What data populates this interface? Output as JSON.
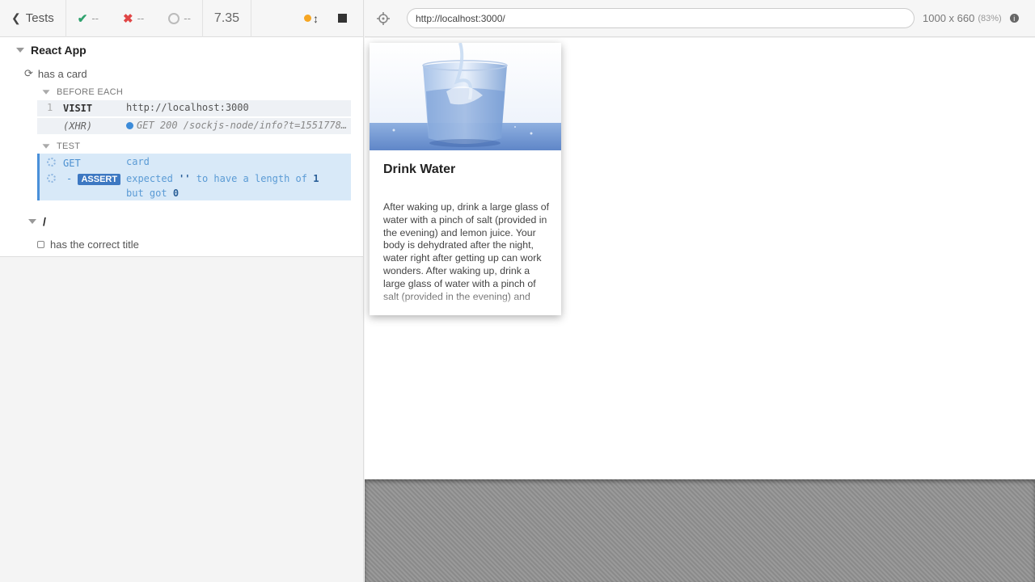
{
  "reporter": {
    "tests_label": "Tests",
    "stats": {
      "passed": "--",
      "failed": "--",
      "pending": "--"
    },
    "duration": "7.35",
    "suites": [
      {
        "title": "React App",
        "tests": [
          {
            "title": "has a card",
            "hooks": [
              {
                "title": "BEFORE EACH",
                "commands": [
                  {
                    "number": "1",
                    "name": "VISIT",
                    "message": "http://localhost:3000"
                  },
                  {
                    "number": "",
                    "name": "(XHR)",
                    "message": "GET 200 /sockjs-node/info?t=1551778..."
                  }
                ]
              },
              {
                "title": "TEST",
                "commands": [
                  {
                    "name": "GET",
                    "message": "card"
                  },
                  {
                    "prefix": "-",
                    "name": "ASSERT",
                    "message_parts": [
                      "expected",
                      "''",
                      "to have a length of",
                      "1",
                      "but got",
                      "0"
                    ]
                  }
                ]
              }
            ]
          }
        ]
      },
      {
        "title": "/",
        "tests": [
          {
            "title": "has the correct title"
          }
        ]
      }
    ]
  },
  "aut": {
    "url": "http://localhost:3000/",
    "viewport": "1000 x 660",
    "scale": "(83%)",
    "card": {
      "title": "Drink Water",
      "text": "After waking up, drink a large glass of water with a pinch of salt (provided in the evening) and lemon juice. Your body is dehydrated after the night, water right after getting up can work wonders. After waking up, drink a large glass of water with a pinch of salt (provided in the evening) and lemon juice."
    }
  },
  "colors": {
    "pass": "#2fa26e",
    "fail": "#e04646",
    "running": "#f6a623",
    "accent": "#4a90d9"
  }
}
